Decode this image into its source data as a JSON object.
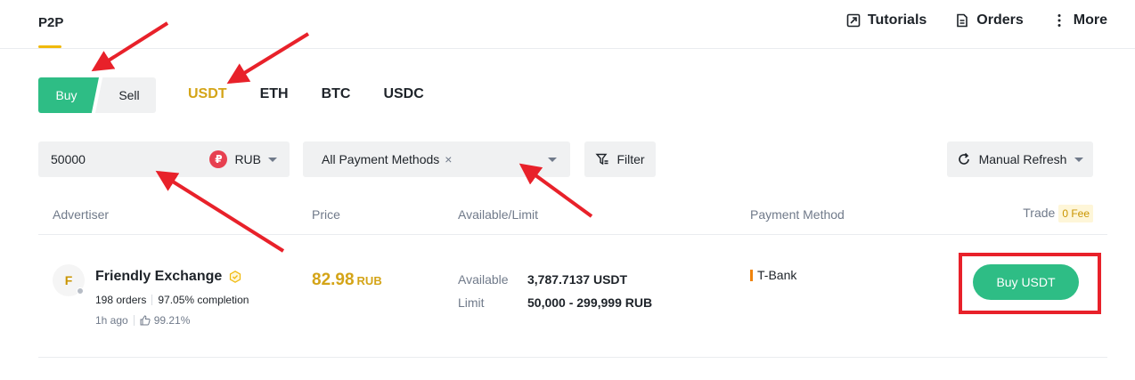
{
  "nav": {
    "brand": "P2P",
    "tutorials": "Tutorials",
    "orders": "Orders",
    "more": "More"
  },
  "side_tabs": {
    "buy": "Buy",
    "sell": "Sell",
    "active": "Buy"
  },
  "coins": [
    "USDT",
    "ETH",
    "BTC",
    "USDC"
  ],
  "active_coin": "USDT",
  "filters": {
    "amount": "50000",
    "currency": "RUB",
    "payment_methods": "All Payment Methods",
    "filter_label": "Filter",
    "refresh_label": "Manual Refresh"
  },
  "table": {
    "headers": {
      "advertiser": "Advertiser",
      "price": "Price",
      "available": "Available/Limit",
      "payment": "Payment Method",
      "trade": "Trade",
      "fee": "0 Fee"
    },
    "rows": [
      {
        "avatar_letter": "F",
        "name": "Friendly Exchange",
        "orders": "198 orders",
        "completion": "97.05% completion",
        "time": "1h ago",
        "rating": "99.21%",
        "price": "82.98",
        "price_currency": "RUB",
        "available_label": "Available",
        "available_value": "3,787.7137 USDT",
        "limit_label": "Limit",
        "limit_value": "50,000 - 299,999 RUB",
        "payment_method": "T-Bank",
        "action": "Buy USDT"
      }
    ]
  },
  "colors": {
    "buy_green": "#2ebd85",
    "accent_gold": "#d4a417",
    "annotation_red": "#e8212a"
  }
}
